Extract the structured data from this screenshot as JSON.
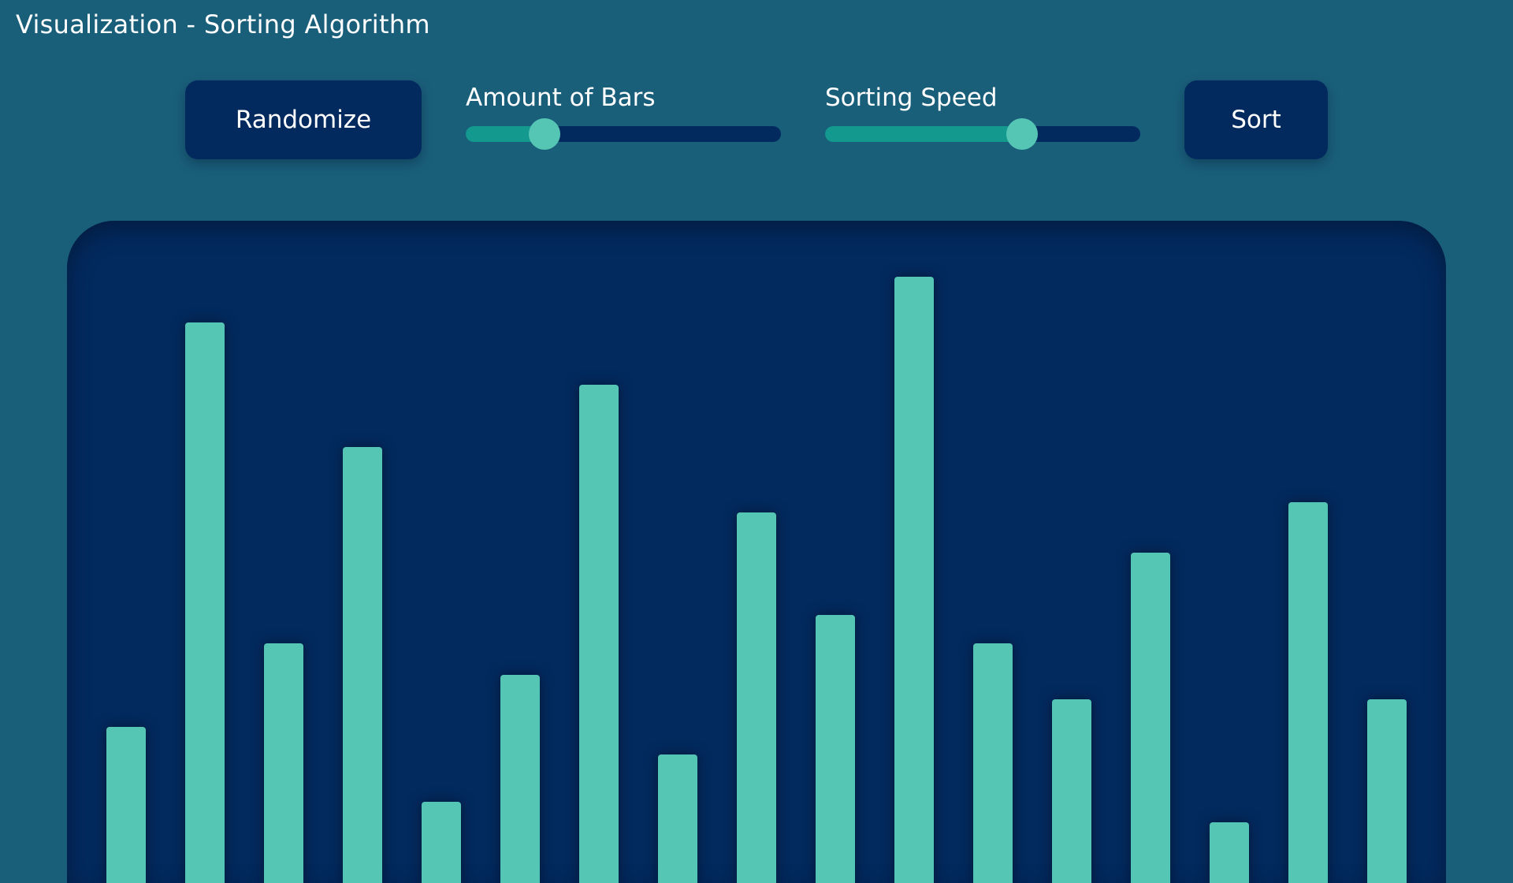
{
  "app": {
    "title": "Visualization - Sorting Algorithm"
  },
  "controls": {
    "randomize_label": "Randomize",
    "sort_label": "Sort",
    "amount_slider": {
      "label": "Amount of Bars",
      "value_fraction": 0.25
    },
    "speed_slider": {
      "label": "Sorting Speed",
      "value_fraction": 0.625
    }
  },
  "colors": {
    "background": "#1a5f7a",
    "panel": "#032a5e",
    "bar": "#56c6b4",
    "slider_fill": "#14998f",
    "slider_thumb": "#56c6b4"
  },
  "chart_data": {
    "type": "bar",
    "values": [
      158,
      671,
      264,
      513,
      63,
      224,
      592,
      123,
      430,
      300,
      729,
      264,
      193,
      379,
      37,
      443,
      193
    ]
  }
}
